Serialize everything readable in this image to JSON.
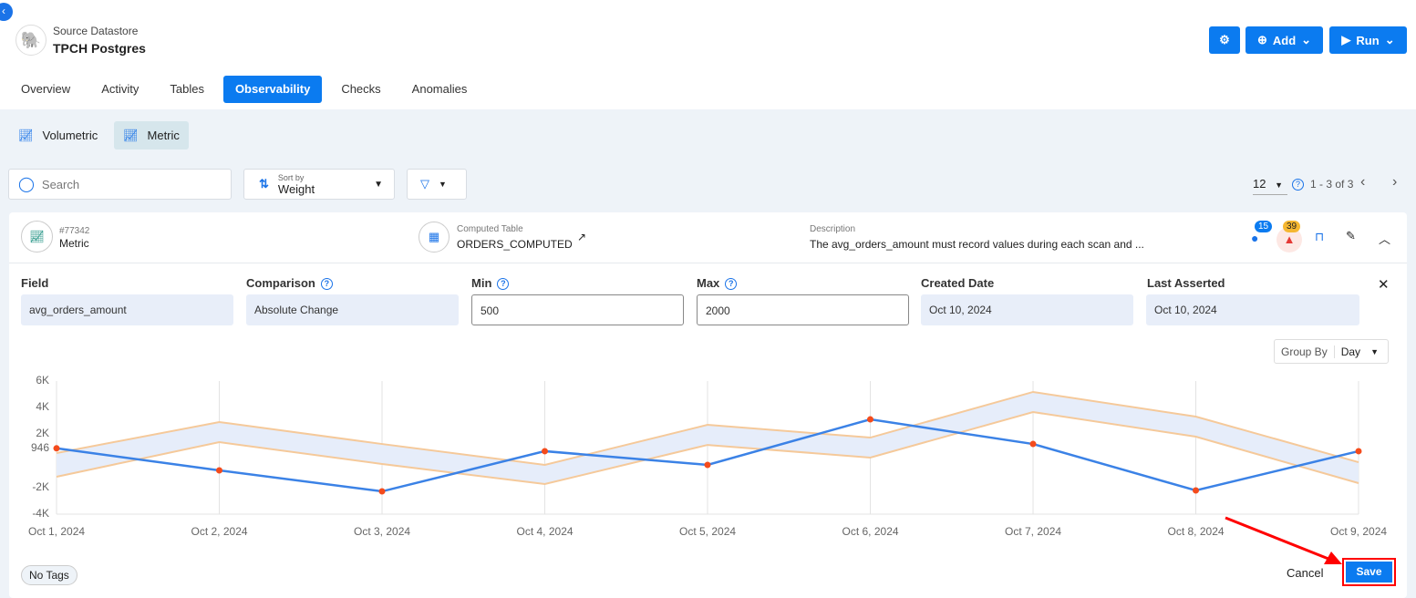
{
  "header": {
    "source_label": "Source Datastore",
    "source_name": "TPCH Postgres",
    "add_label": "Add",
    "run_label": "Run"
  },
  "tabs": [
    "Overview",
    "Activity",
    "Tables",
    "Observability",
    "Checks",
    "Anomalies"
  ],
  "active_tab": "Observability",
  "subtabs": [
    "Volumetric",
    "Metric"
  ],
  "toolbar": {
    "search_placeholder": "Search",
    "sort_label": "Sort by",
    "sort_value": "Weight",
    "page_size": "12",
    "page_range": "1 - 3 of 3"
  },
  "check": {
    "id": "#77342",
    "type": "Metric",
    "table_label": "Computed Table",
    "table_name": "ORDERS_COMPUTED",
    "desc_label": "Description",
    "description": "The avg_orders_amount must record values during each scan and ...",
    "badge_blue": "15",
    "badge_orange": "39"
  },
  "fields": {
    "field_label": "Field",
    "field_value": "avg_orders_amount",
    "comparison_label": "Comparison",
    "comparison_value": "Absolute Change",
    "min_label": "Min",
    "min_value": "500",
    "max_label": "Max",
    "max_value": "2000",
    "created_label": "Created Date",
    "created_value": "Oct 10, 2024",
    "asserted_label": "Last Asserted",
    "asserted_value": "Oct 10, 2024"
  },
  "group_by": {
    "label": "Group By",
    "value": "Day"
  },
  "footer": {
    "tags": "No Tags",
    "cancel": "Cancel",
    "save": "Save"
  },
  "colors": {
    "accent": "#0b7bf0",
    "series": "#3b82e6",
    "band": "#f5c99a",
    "band_fill": "#e6edfa",
    "point": "#f44b1c",
    "highlight": "#ff0000"
  },
  "chart_data": {
    "type": "line",
    "x": [
      "Oct 1, 2024",
      "Oct 2, 2024",
      "Oct 3, 2024",
      "Oct 4, 2024",
      "Oct 5, 2024",
      "Oct 6, 2024",
      "Oct 7, 2024",
      "Oct 8, 2024",
      "Oct 9, 2024"
    ],
    "yticks": [
      "6K",
      "4K",
      "2K",
      "946",
      "-2K",
      "-4K"
    ],
    "ytick_values": [
      6000,
      4000,
      2000,
      946,
      -2000,
      -4000
    ],
    "ylim": [
      -4000,
      6000
    ],
    "grid": "vertical",
    "values": [
      946,
      -710,
      -2290,
      730,
      -300,
      3120,
      1270,
      -2220,
      730
    ],
    "band_upper": [
      590,
      2920,
      1270,
      -300,
      2710,
      1750,
      5180,
      3330,
      -100
    ],
    "band_lower": [
      -1190,
      1410,
      -230,
      -1740,
      1200,
      250,
      3670,
      1820,
      -1670
    ]
  }
}
